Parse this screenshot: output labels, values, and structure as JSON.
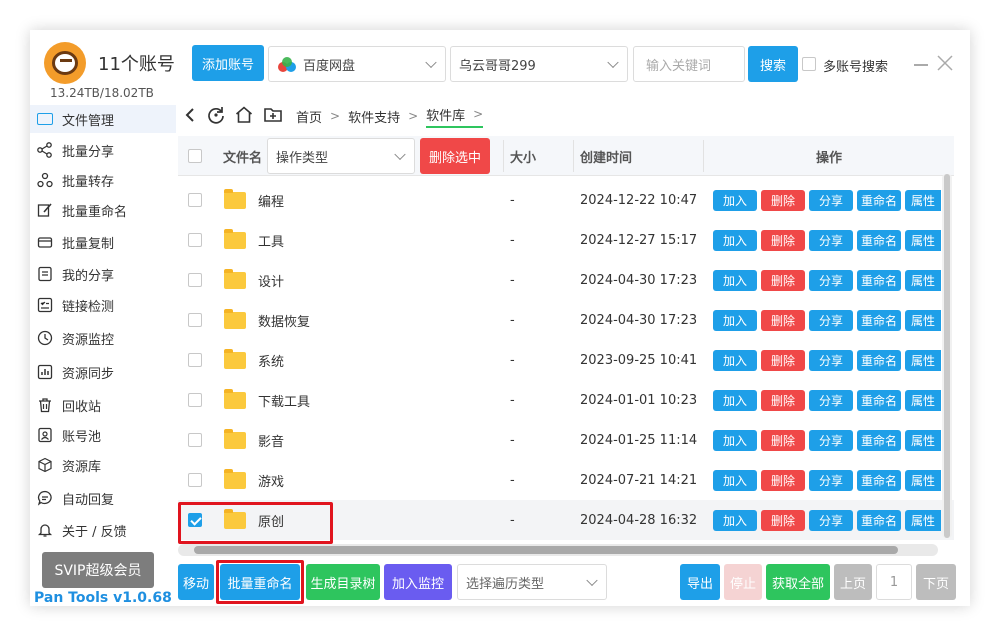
{
  "header": {
    "account_title": "11个账号",
    "storage": "13.24TB/18.02TB",
    "add_account_label": "添加账号",
    "cloud_select": "百度网盘",
    "account_select": "乌云哥哥299",
    "search_placeholder": "输入关键词",
    "search_label": "搜索",
    "multi_account_label": "多账号搜索"
  },
  "sidebar": {
    "items": [
      {
        "label": "文件管理",
        "icon": "folder-icon"
      },
      {
        "label": "批量分享",
        "icon": "share-icon"
      },
      {
        "label": "批量转存",
        "icon": "transfer-icon"
      },
      {
        "label": "批量重命名",
        "icon": "edit-icon"
      },
      {
        "label": "批量复制",
        "icon": "copy-icon"
      },
      {
        "label": "我的分享",
        "icon": "document-icon"
      },
      {
        "label": "链接检测",
        "icon": "check-list-icon"
      },
      {
        "label": "资源监控",
        "icon": "clock-icon"
      },
      {
        "label": "资源同步",
        "icon": "chart-icon"
      },
      {
        "label": "回收站",
        "icon": "trash-icon"
      },
      {
        "label": "账号池",
        "icon": "id-card-icon"
      },
      {
        "label": "资源库",
        "icon": "cube-icon"
      },
      {
        "label": "自动回复",
        "icon": "chat-icon"
      },
      {
        "label": "关于 / 反馈",
        "icon": "bell-icon"
      }
    ],
    "svip_label": "SVIP超级会员",
    "version": "Pan Tools v1.0.68"
  },
  "breadcrumb": {
    "items": [
      "首页",
      "软件支持",
      "软件库"
    ]
  },
  "table": {
    "headers": {
      "name": "文件名",
      "op_type_select": "操作类型",
      "delete_selected": "删除选中",
      "size": "大小",
      "created": "创建时间",
      "actions": "操作"
    },
    "rows": [
      {
        "name": "编程",
        "size": "-",
        "created": "2024-12-22 10:47",
        "checked": false
      },
      {
        "name": "工具",
        "size": "-",
        "created": "2024-12-27 15:17",
        "checked": false
      },
      {
        "name": "设计",
        "size": "-",
        "created": "2024-04-30 17:23",
        "checked": false
      },
      {
        "name": "数据恢复",
        "size": "-",
        "created": "2024-04-30 17:23",
        "checked": false
      },
      {
        "name": "系统",
        "size": "-",
        "created": "2023-09-25 10:41",
        "checked": false
      },
      {
        "name": "下载工具",
        "size": "-",
        "created": "2024-01-01 10:23",
        "checked": false
      },
      {
        "name": "影音",
        "size": "-",
        "created": "2024-01-25 11:14",
        "checked": false
      },
      {
        "name": "游戏",
        "size": "-",
        "created": "2024-07-21 14:21",
        "checked": false
      },
      {
        "name": "原创",
        "size": "-",
        "created": "2024-04-28 16:32",
        "checked": true
      }
    ],
    "row_actions": {
      "add": "加入",
      "delete": "删除",
      "share": "分享",
      "rename": "重命名",
      "props": "属性"
    }
  },
  "footer": {
    "move": "移动",
    "batch_rename": "批量重命名",
    "gen_tree": "生成目录树",
    "add_monitor": "加入监控",
    "traverse_select": "选择遍历类型",
    "export": "导出",
    "stop": "停止",
    "get_all": "获取全部",
    "prev": "上页",
    "page": "1",
    "next": "下页"
  },
  "colors": {
    "primary": "#1e9fe8",
    "danger": "#f04848",
    "success": "#2ec55e",
    "purple": "#6a5cf0",
    "highlight_box": "#e0141e"
  }
}
